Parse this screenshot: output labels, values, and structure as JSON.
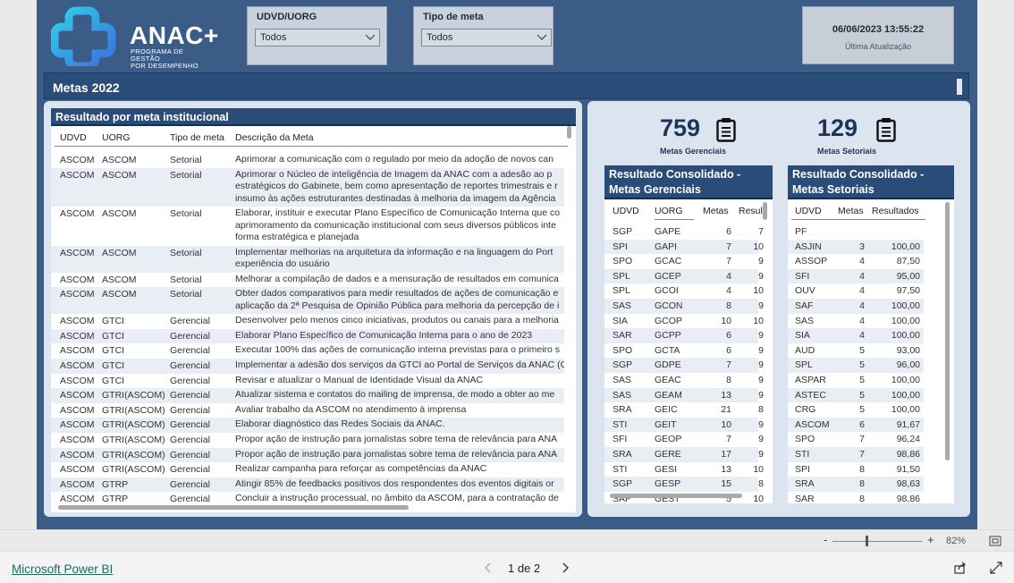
{
  "logo": {
    "name": "ANAC+",
    "subtitle_line1": "PROGRAMA DE GESTÃO",
    "subtitle_line2": "POR DESEMPENHO"
  },
  "filters": [
    {
      "title": "UDVD/UORG",
      "value": "Todos"
    },
    {
      "title": "Tipo de meta",
      "value": "Todos"
    }
  ],
  "last_update": {
    "datetime": "06/06/2023 13:55:22",
    "label": "Última Atualização"
  },
  "page_title": "Metas 2022",
  "kpis": {
    "gerenciais": {
      "value": "759",
      "label": "Metas Gerenciais"
    },
    "setoriais": {
      "value": "129",
      "label": "Metas Setoriais"
    }
  },
  "results_table": {
    "title": "Resultado por meta institucional",
    "columns": [
      "UDVD",
      "UORG",
      "Tipo de meta",
      "Descrição da Meta"
    ],
    "rows": [
      {
        "udvd": "ASCOM",
        "uorg": "ASCOM",
        "tipo": "Setorial",
        "desc": [
          "Aprimorar a comunicação com o regulado por meio da adoção de novos can"
        ]
      },
      {
        "udvd": "ASCOM",
        "uorg": "ASCOM",
        "tipo": "Setorial",
        "desc": [
          "Aprimorar o Núcleo de inteligência de Imagem da ANAC com a adesão ao p",
          "estratégicos do Gabinete, bem como apresentação de reportes trimestrais e r",
          "insumo às ações estruturantes destinadas à melhoria da imagem da Agência"
        ]
      },
      {
        "udvd": "ASCOM",
        "uorg": "ASCOM",
        "tipo": "Setorial",
        "desc": [
          "Elaborar, instituir e executar Plano Específico de Comunicação Interna que co",
          "aprimoramento da comunicação institucional com seus diversos públicos inte",
          "forma estratégica e planejada"
        ]
      },
      {
        "udvd": "ASCOM",
        "uorg": "ASCOM",
        "tipo": "Setorial",
        "desc": [
          "Implementar melhorias na arquitetura da informação e na linguagem do Port",
          "experiência do usuário"
        ]
      },
      {
        "udvd": "ASCOM",
        "uorg": "ASCOM",
        "tipo": "Setorial",
        "desc": [
          "Melhorar a compilação de dados e a mensuração de resultados em comunica"
        ]
      },
      {
        "udvd": "ASCOM",
        "uorg": "ASCOM",
        "tipo": "Setorial",
        "desc": [
          "Obter dados comparativos para medir resultados de ações de comunicação e",
          "aplicação da 2ª Pesquisa de Opinião Pública para melhoria da percepção de i"
        ]
      },
      {
        "udvd": "ASCOM",
        "uorg": "GTCI",
        "tipo": "Gerencial",
        "desc": [
          "Desenvolver pelo menos cinco iniciativas, produtos ou canais para a melhoria"
        ]
      },
      {
        "udvd": "ASCOM",
        "uorg": "GTCI",
        "tipo": "Gerencial",
        "desc": [
          "Elaborar Plano Específico de Comunicação Interna para o ano de 2023"
        ]
      },
      {
        "udvd": "ASCOM",
        "uorg": "GTCI",
        "tipo": "Gerencial",
        "desc": [
          "Executar 100% das ações de comunicação interna previstas para o primeiro s"
        ]
      },
      {
        "udvd": "ASCOM",
        "uorg": "GTCI",
        "tipo": "Gerencial",
        "desc": [
          "Implementar a adesão dos serviços da GTCI ao Portal de Serviços da ANAC (G"
        ]
      },
      {
        "udvd": "ASCOM",
        "uorg": "GTCI",
        "tipo": "Gerencial",
        "desc": [
          "Revisar e atualizar o Manual de Identidade Visual da ANAC"
        ]
      },
      {
        "udvd": "ASCOM",
        "uorg": "GTRI(ASCOM)",
        "tipo": "Gerencial",
        "desc": [
          "Atualizar sistema e contatos do mailing de imprensa, de modo a obter ao me"
        ]
      },
      {
        "udvd": "ASCOM",
        "uorg": "GTRI(ASCOM)",
        "tipo": "Gerencial",
        "desc": [
          "Avaliar trabalho da ASCOM no atendimento à imprensa"
        ]
      },
      {
        "udvd": "ASCOM",
        "uorg": "GTRI(ASCOM)",
        "tipo": "Gerencial",
        "desc": [
          "Elaborar diagnóstico das Redes Sociais da ANAC."
        ]
      },
      {
        "udvd": "ASCOM",
        "uorg": "GTRI(ASCOM)",
        "tipo": "Gerencial",
        "desc": [
          "Propor ação de instrução para jornalistas sobre tema de relevância para ANA"
        ]
      },
      {
        "udvd": "ASCOM",
        "uorg": "GTRI(ASCOM)",
        "tipo": "Gerencial",
        "desc": [
          "Propor ação de instrução para jornalistas sobre tema de relevância para ANA"
        ]
      },
      {
        "udvd": "ASCOM",
        "uorg": "GTRI(ASCOM)",
        "tipo": "Gerencial",
        "desc": [
          "Realizar campanha para reforçar as competências da ANAC"
        ]
      },
      {
        "udvd": "ASCOM",
        "uorg": "GTRP",
        "tipo": "Gerencial",
        "desc": [
          "Atingir 85% de feedbacks positivos dos respondentes dos eventos digitais or"
        ]
      },
      {
        "udvd": "ASCOM",
        "uorg": "GTRP",
        "tipo": "Gerencial",
        "desc": [
          "Concluir a instrução processual, no âmbito da ASCOM, para a contratação de"
        ]
      }
    ]
  },
  "gerenciais_table": {
    "title_line1": "Resultado Consolidado -",
    "title_line2": "Metas Gerenciais",
    "columns": [
      "UDVD",
      "UORG",
      "Metas",
      "Resultado"
    ],
    "rows": [
      [
        "SGP",
        "GAPE",
        "6",
        "7"
      ],
      [
        "SPI",
        "GAPI",
        "7",
        "10"
      ],
      [
        "SPO",
        "GCAC",
        "7",
        "9"
      ],
      [
        "SPL",
        "GCEP",
        "4",
        "9"
      ],
      [
        "SPL",
        "GCOI",
        "4",
        "10"
      ],
      [
        "SAS",
        "GCON",
        "8",
        "9"
      ],
      [
        "SIA",
        "GCOP",
        "10",
        "10"
      ],
      [
        "SAR",
        "GCPP",
        "6",
        "9"
      ],
      [
        "SPO",
        "GCTA",
        "6",
        "9"
      ],
      [
        "SGP",
        "GDPE",
        "7",
        "9"
      ],
      [
        "SAS",
        "GEAC",
        "8",
        "9"
      ],
      [
        "SAS",
        "GEAM",
        "13",
        "9"
      ],
      [
        "SRA",
        "GEIC",
        "21",
        "8"
      ],
      [
        "STI",
        "GEIT",
        "10",
        "9"
      ],
      [
        "SFI",
        "GEOP",
        "7",
        "9"
      ],
      [
        "SRA",
        "GERE",
        "17",
        "9"
      ],
      [
        "STI",
        "GESI",
        "13",
        "10"
      ],
      [
        "SGP",
        "GESP",
        "15",
        "8"
      ],
      [
        "SAF",
        "GEST",
        "5",
        "10"
      ]
    ]
  },
  "setoriais_table": {
    "title_line1": "Resultado Consolidado -",
    "title_line2": "Metas Setoriais",
    "columns": [
      "UDVD",
      "Metas",
      "Resultados"
    ],
    "rows": [
      [
        "PF",
        "",
        ""
      ],
      [
        "ASJIN",
        "3",
        "100,00"
      ],
      [
        "ASSOP",
        "4",
        "87,50"
      ],
      [
        "SFI",
        "4",
        "95,00"
      ],
      [
        "OUV",
        "4",
        "97,50"
      ],
      [
        "SAF",
        "4",
        "100,00"
      ],
      [
        "SAS",
        "4",
        "100,00"
      ],
      [
        "SIA",
        "4",
        "100,00"
      ],
      [
        "AUD",
        "5",
        "93,00"
      ],
      [
        "SPL",
        "5",
        "96,00"
      ],
      [
        "ASPAR",
        "5",
        "100,00"
      ],
      [
        "ASTEC",
        "5",
        "100,00"
      ],
      [
        "CRG",
        "5",
        "100,00"
      ],
      [
        "ASCOM",
        "6",
        "91,67"
      ],
      [
        "SPO",
        "7",
        "96,24"
      ],
      [
        "STI",
        "7",
        "98,86"
      ],
      [
        "SPI",
        "8",
        "91,50"
      ],
      [
        "SRA",
        "8",
        "98,63"
      ],
      [
        "SAR",
        "8",
        "98,86"
      ]
    ]
  },
  "zoom": {
    "minus": "-",
    "plus": "+",
    "level": "82%"
  },
  "footer": {
    "brand": "Microsoft Power BI",
    "pager": "1 de 2"
  }
}
